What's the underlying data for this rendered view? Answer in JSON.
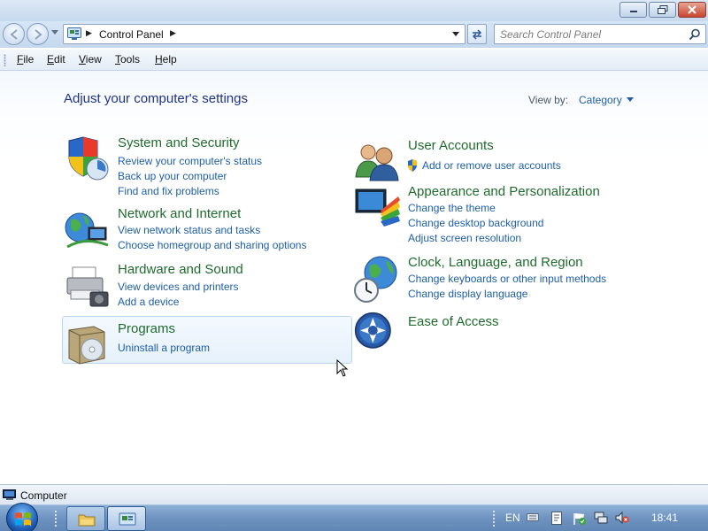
{
  "address": {
    "path": "Control Panel",
    "search_placeholder": "Search Control Panel"
  },
  "menu": {
    "file": {
      "pre": "",
      "key": "F",
      "post": "ile"
    },
    "edit": {
      "pre": "",
      "key": "E",
      "post": "dit"
    },
    "view": {
      "pre": "",
      "key": "V",
      "post": "iew"
    },
    "tools": {
      "pre": "",
      "key": "T",
      "post": "ools"
    },
    "help": {
      "pre": "",
      "key": "H",
      "post": "elp"
    }
  },
  "page": {
    "title": "Adjust your computer's settings",
    "view_by_label": "View by:",
    "view_by_value": "Category"
  },
  "categories": {
    "system_security": {
      "title": "System and Security",
      "links": [
        "Review your computer's status",
        "Back up your computer",
        "Find and fix problems"
      ]
    },
    "network": {
      "title": "Network and Internet",
      "links": [
        "View network status and tasks",
        "Choose homegroup and sharing options"
      ]
    },
    "hardware": {
      "title": "Hardware and Sound",
      "links": [
        "View devices and printers",
        "Add a device"
      ]
    },
    "programs": {
      "title": "Programs",
      "links": [
        "Uninstall a program"
      ]
    },
    "user_accounts": {
      "title": "User Accounts",
      "links": [
        "Add or remove user accounts"
      ]
    },
    "appearance": {
      "title": "Appearance and Personalization",
      "links": [
        "Change the theme",
        "Change desktop background",
        "Adjust screen resolution"
      ]
    },
    "clock": {
      "title": "Clock, Language, and Region",
      "links": [
        "Change keyboards or other input methods",
        "Change display language"
      ]
    },
    "ease": {
      "title": "Ease of Access",
      "links": []
    }
  },
  "status": {
    "text": "Computer"
  },
  "taskbar": {
    "language": "EN",
    "clock": "18:41"
  },
  "colors": {
    "category_title": "#1f6b2e",
    "link": "#1e5fa8",
    "heading": "#1e3287"
  }
}
